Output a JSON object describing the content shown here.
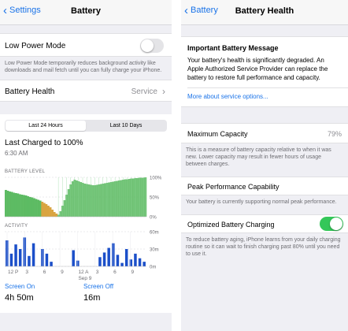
{
  "colors": {
    "accent": "#1a73e8",
    "green": "#34c759",
    "chart_green": "#5dbb63",
    "chart_orange": "#d9a441",
    "chart_blue": "#1b4fc9"
  },
  "left": {
    "nav": {
      "back_label": "Settings",
      "title": "Battery"
    },
    "low_power": {
      "label": "Low Power Mode",
      "enabled": false,
      "note": "Low Power Mode temporarily reduces background activity like downloads and mail fetch until you can fully charge your iPhone."
    },
    "battery_health": {
      "label": "Battery Health",
      "value": "Service"
    },
    "segments": [
      "Last 24 Hours",
      "Last 10 Days"
    ],
    "selected_segment": "Last 24 Hours",
    "last_charged": {
      "label": "Last Charged to 100%",
      "time": "6:30 AM"
    },
    "battery_level_label": "BATTERY LEVEL",
    "activity_label": "ACTIVITY",
    "screen_on": {
      "label": "Screen On",
      "value": "4h 50m"
    },
    "screen_off": {
      "label": "Screen Off",
      "value": "16m"
    }
  },
  "right": {
    "nav": {
      "back_label": "Battery",
      "title": "Battery Health"
    },
    "message": {
      "title": "Important Battery Message",
      "body": "Your battery's health is significantly degraded. An Apple Authorized Service Provider can replace the battery to restore full performance and capacity.",
      "link": "More about service options..."
    },
    "max_capacity": {
      "label": "Maximum Capacity",
      "value": "79%",
      "note": "This is a measure of battery capacity relative to when it was new. Lower capacity may result in fewer hours of usage between charges."
    },
    "peak_performance": {
      "label": "Peak Performance Capability",
      "note": "Your battery is currently supporting normal peak performance."
    },
    "optimized_charging": {
      "label": "Optimized Battery Charging",
      "enabled": true,
      "note": "To reduce battery aging, iPhone learns from your daily charging routine so it can wait to finish charging past 80% until you need to use it."
    }
  },
  "chart_data": [
    {
      "type": "area",
      "title": "BATTERY LEVEL",
      "y_tick_labels": [
        "100%",
        "50%",
        "0%"
      ],
      "ylim": [
        0,
        100
      ],
      "values": [
        68,
        66,
        64,
        63,
        61,
        60,
        59,
        57,
        56,
        55,
        54,
        52,
        50,
        49,
        47,
        45,
        43,
        41,
        38,
        35,
        32,
        28,
        24,
        18,
        12,
        8,
        5,
        14,
        28,
        42,
        56,
        70,
        82,
        90,
        94,
        92,
        90,
        88,
        86,
        84,
        83,
        82,
        81,
        80,
        80,
        81,
        82,
        83,
        84,
        85,
        86,
        87,
        88,
        89,
        90,
        91,
        92,
        93,
        94,
        95,
        95,
        96,
        97,
        97,
        98,
        98,
        99,
        99,
        99,
        100
      ],
      "charging_start_index": 26,
      "low_segment_range": [
        18,
        30
      ],
      "grid": true
    },
    {
      "type": "bar",
      "title": "ACTIVITY",
      "y_tick_labels": [
        "60m",
        "30m",
        "0m"
      ],
      "ylim": [
        0,
        60
      ],
      "values": [
        45,
        22,
        38,
        30,
        50,
        18,
        40,
        0,
        30,
        22,
        8,
        0,
        0,
        0,
        0,
        28,
        10,
        0,
        0,
        0,
        0,
        16,
        24,
        32,
        40,
        20,
        6,
        30,
        12,
        22,
        14,
        8
      ],
      "x_tick_labels": [
        "12 P",
        "3",
        "6",
        "9",
        "12 A",
        "3",
        "6",
        "9"
      ],
      "x_sub_label": "Sep 9",
      "grid": true
    }
  ]
}
